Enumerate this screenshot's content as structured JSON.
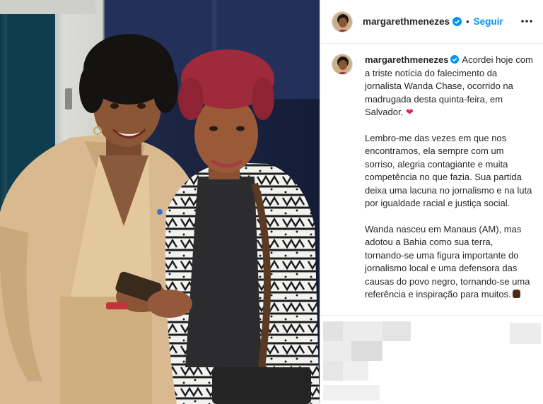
{
  "post": {
    "username": "margarethmenezes",
    "follow_label": "Seguir",
    "separator": "•",
    "more_icon": "more-horizontal-icon",
    "verified_color": "#0095f6"
  },
  "caption": {
    "username": "margarethmenezes",
    "line1": "Acordei hoje com a triste notícia do falecimento da jornalista Wanda Chase, ocorrido na madrugada desta quinta-feira, em Salvador.",
    "heart": "❤",
    "paragraph2": "Lembro-me das vezes em que nos encontramos, ela sempre com um sorriso, alegria contagiante e muita competência no que fazia. Sua partida deixa uma lacuna no jornalismo e na luta por igualdade racial e justiça social.",
    "paragraph3": "Wanda nasceu em Manaus (AM), mas adotou a Bahia como sua terra, tornando-se uma figura importante do jornalismo local e uma defensora das causas do povo negro, tornando-se uma referência e inspiração para muitos."
  },
  "colors": {
    "accent": "#0095f6",
    "text": "#262626",
    "heart": "#e0245e"
  }
}
